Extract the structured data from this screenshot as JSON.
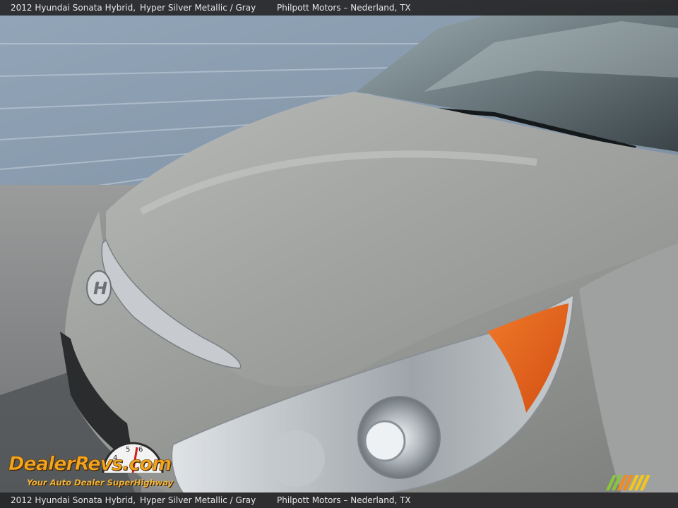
{
  "caption": {
    "vehicle": "2012 Hyundai Sonata Hybrid,",
    "color": "Hyper Silver Metallic / Gray",
    "dealer": "Philpott Motors – Nederland, TX"
  },
  "watermark": {
    "brand": "DealerRevs.com",
    "tagline": "Your Auto Dealer SuperHighway"
  },
  "colors": {
    "paint": "#a9aaa7",
    "wall": "#8d9fb1",
    "amber": "#e8641e",
    "stripe_green": "#8bc43f",
    "stripe_orange": "#f28a1e",
    "stripe_yellow": "#f2c51e"
  }
}
